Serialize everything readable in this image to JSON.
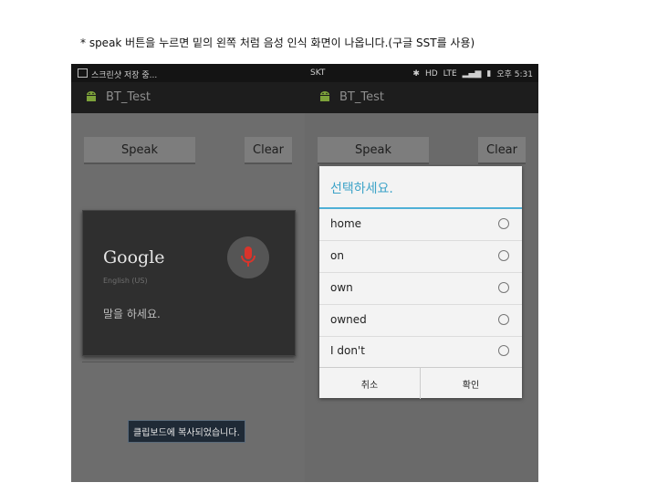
{
  "caption": "* speak 버튼을 누르면 밑의 왼쪽 처럼 음성 인식 화면이 나옵니다.(구글 SST를 사용)",
  "left_phone": {
    "status_text": "스크린샷 저장 중...",
    "app_title": "BT_Test",
    "speak_button": "Speak",
    "clear_button": "Clear",
    "google_logo": "Google",
    "language": "English (US)",
    "prompt": "말을 하세요.",
    "toast": "클립보드에 복사되었습니다."
  },
  "right_phone": {
    "carrier": "SKT",
    "hd": "HD",
    "lte": "LTE",
    "clock": "오후 5:31",
    "app_title": "BT_Test",
    "speak_button": "Speak",
    "clear_button": "Clear",
    "dialog_title": "선택하세요.",
    "options": [
      "home",
      "on",
      "own",
      "owned",
      "I don't"
    ],
    "cancel": "취소",
    "ok": "확인"
  },
  "colors": {
    "accent": "#3da3c8",
    "mic": "#d9342b"
  },
  "icons": [
    "image-icon",
    "android-icon",
    "microphone-icon",
    "bluetooth-icon",
    "signal-icon",
    "battery-icon",
    "alarm-icon"
  ]
}
